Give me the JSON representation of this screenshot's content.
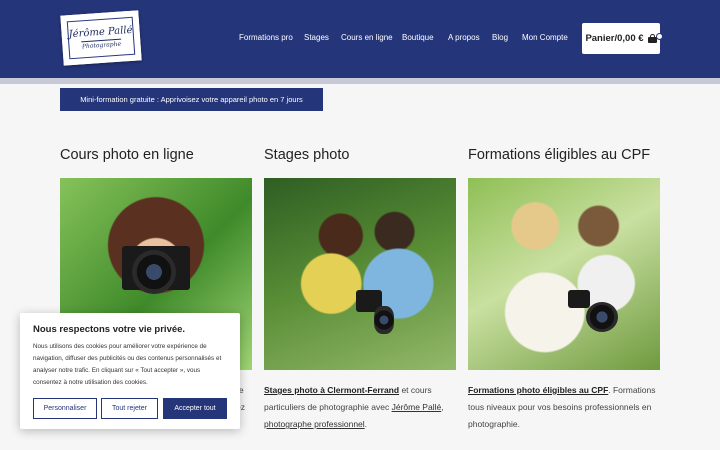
{
  "header": {
    "logo_name": "Jérôme Pallé",
    "logo_sub": "Photographe",
    "nav": [
      "Formations pro",
      "Stages",
      "Cours en ligne",
      "Boutique",
      "A propos",
      "Blog",
      "Mon Compte"
    ],
    "cart_label": "Panier/0,00 €"
  },
  "promo": {
    "label": "Mini-formation gratuite : Apprivoisez votre appareil photo en 7 jours"
  },
  "columns": [
    {
      "title": "Cours photo en ligne"
    },
    {
      "title": "Stages photo",
      "desc_link": "Stages photo à Clermont-Ferrand",
      "desc_mid": " et cours particuliers de photographie avec ",
      "desc_link2": "Jérôme Pallé",
      "desc_sep": ", ",
      "desc_link3": "photographe professionnel",
      "desc_end": "."
    },
    {
      "title": "Formations éligibles au CPF",
      "desc_link": "Formations photo éligibles au CPF",
      "desc_rest": ". Formations tous niveaux pour vos besoins professionnels en photographie."
    }
  ],
  "col1_hidden_fragments": [
    "re",
    "ez"
  ],
  "cookie": {
    "title": "Nous respectons votre vie privée.",
    "text": "Nous utilisons des cookies pour améliorer votre expérience de navigation, diffuser des publicités ou des contenus personnalisés et analyser notre trafic. En cliquant sur « Tout accepter », vous consentez à notre utilisation des cookies.",
    "btn_customize": "Personnaliser",
    "btn_reject": "Tout rejeter",
    "btn_accept": "Accepter tout"
  },
  "colors": {
    "primary": "#25357a",
    "background": "#f6f6f6"
  }
}
